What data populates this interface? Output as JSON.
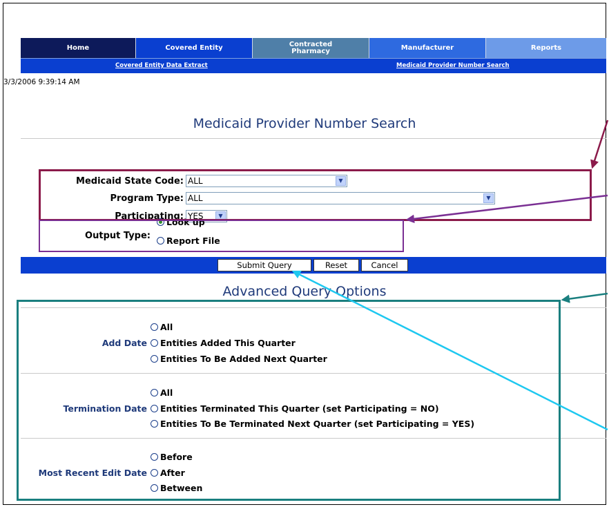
{
  "nav": {
    "tabs": [
      {
        "label": "Home"
      },
      {
        "label": "Covered Entity"
      },
      {
        "label": "Contracted Pharmacy"
      },
      {
        "label": "Manufacturer"
      },
      {
        "label": "Reports"
      }
    ],
    "sub_links": [
      "Covered Entity Data Extract",
      "Medicaid Provider Number Search"
    ]
  },
  "timestamp": "3/3/2006 9:39:14 AM",
  "page_title": "Medicaid Provider Number Search",
  "form": {
    "state_code": {
      "label": "Medicaid State Code:",
      "value": "ALL"
    },
    "program_type": {
      "label": "Program Type:",
      "value": "ALL"
    },
    "participating": {
      "label": "Participating:",
      "value": "YES"
    },
    "output_type": {
      "label": "Output Type:",
      "options": [
        "Look up",
        "Report File"
      ],
      "selected": "Look up"
    }
  },
  "buttons": {
    "submit": "Submit Query",
    "reset": "Reset",
    "cancel": "Cancel"
  },
  "advanced": {
    "title": "Advanced Query Options",
    "add_date": {
      "label": "Add Date",
      "options": [
        "All",
        "Entities Added This Quarter",
        "Entities To Be Added Next Quarter"
      ]
    },
    "termination_date": {
      "label": "Termination Date",
      "options": [
        "All",
        "Entities Terminated This Quarter (set Participating = NO)",
        "Entities To Be Terminated Next Quarter (set Participating = YES)"
      ]
    },
    "recent_edit": {
      "label": "Most Recent Edit Date",
      "options": [
        "Before",
        "After",
        "Between"
      ]
    }
  },
  "colors": {
    "nav_dark": "#0d1a5a",
    "nav_blue": "#0a3fd0",
    "annotation_maroon": "#8b1a4a",
    "annotation_purple": "#7a2f93",
    "annotation_teal": "#1a7f7f",
    "annotation_cyan": "#1ec8f0"
  }
}
